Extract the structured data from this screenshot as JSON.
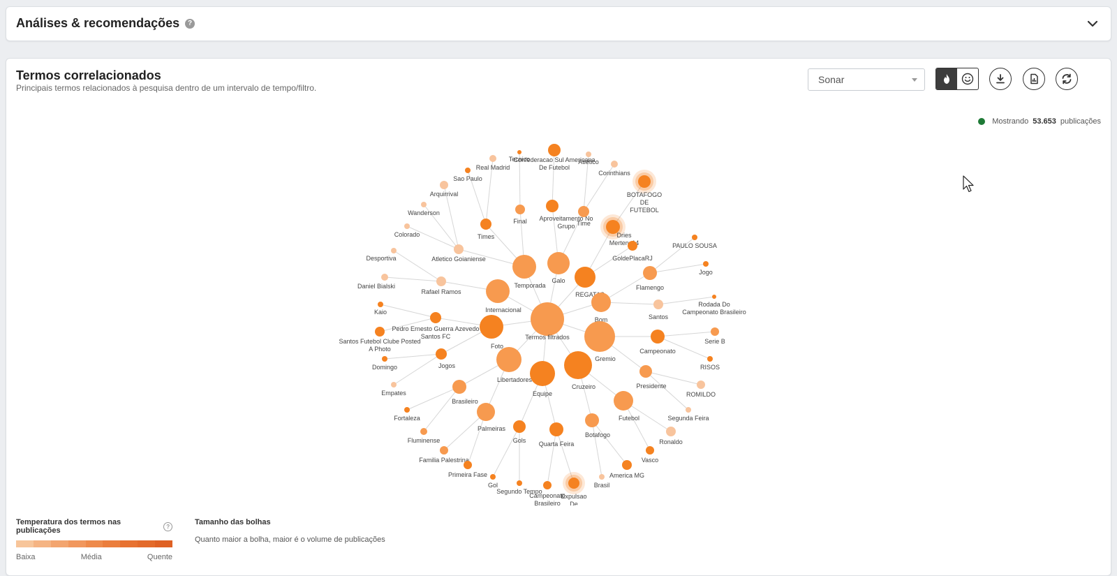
{
  "analises": {
    "title": "Análises & recomendações",
    "help": "?"
  },
  "termos": {
    "title": "Termos correlacionados",
    "subtitle": "Principais termos relacionados à pesquisa dentro de um intervalo de tempo/filtro.",
    "select_value": "Sonar",
    "showing_label": "Mostrando",
    "showing_count": "53.653",
    "showing_suffix": "publicações"
  },
  "legend": {
    "temp_title": "Temperatura dos termos nas publicações",
    "temp_low": "Baixa",
    "temp_mid": "Média",
    "temp_high": "Quente",
    "gradient": [
      "#f7c59a",
      "#f5b483",
      "#f3a56f",
      "#f1975d",
      "#ee8a4b",
      "#eb7e3d",
      "#e77231",
      "#e36a2a",
      "#df6124"
    ],
    "size_title": "Tamanho das bolhas",
    "size_desc": "Quanto maior a bolha, maior é o volume de publicações"
  },
  "colors": {
    "hot": "#f58220",
    "medium": "#f79a4f",
    "low": "#f8c49d",
    "link": "#d6d6d6"
  },
  "graph": {
    "center": {
      "label": "Termos filtrados",
      "heat": "medium"
    },
    "nodes": [
      {
        "id": "temporada",
        "label": "Temporada",
        "heat": "medium",
        "parent": "center"
      },
      {
        "id": "galo",
        "label": "Galo",
        "heat": "medium",
        "parent": "center"
      },
      {
        "id": "regatas",
        "label": "REGATAS",
        "heat": "hot",
        "parent": "center"
      },
      {
        "id": "bom",
        "label": "Bom",
        "heat": "medium",
        "parent": "center"
      },
      {
        "id": "internacional",
        "label": "Internacional",
        "heat": "medium",
        "parent": "center"
      },
      {
        "id": "gremio",
        "label": "Gremio",
        "heat": "medium",
        "parent": "center"
      },
      {
        "id": "foto",
        "label": "Foto",
        "heat": "hot",
        "parent": "center"
      },
      {
        "id": "libertadores",
        "label": "Libertadores",
        "heat": "medium",
        "parent": "center"
      },
      {
        "id": "equipe",
        "label": "Equipe",
        "heat": "hot",
        "parent": "center"
      },
      {
        "id": "cruzeiro",
        "label": "Cruzeiro",
        "heat": "hot",
        "parent": "center"
      },
      {
        "id": "campeonato",
        "label": "Campeonato",
        "heat": "hot",
        "parent": "gremio"
      },
      {
        "id": "presidente",
        "label": "Presidente",
        "heat": "medium",
        "parent": "gremio"
      },
      {
        "id": "futebol",
        "label": "Futebol",
        "heat": "medium",
        "parent": "cruzeiro"
      },
      {
        "id": "botafogo",
        "label": "Botafogo",
        "heat": "medium",
        "parent": "cruzeiro"
      },
      {
        "id": "quartafeira",
        "label": "Quarta Feira",
        "heat": "hot",
        "parent": "equipe"
      },
      {
        "id": "gols",
        "label": "Gols",
        "heat": "hot",
        "parent": "equipe"
      },
      {
        "id": "palmeiras",
        "label": "Palmeiras",
        "heat": "medium",
        "parent": "libertadores"
      },
      {
        "id": "brasileiro",
        "label": "Brasileiro",
        "heat": "medium",
        "parent": "libertadores"
      },
      {
        "id": "jogos",
        "label": "Jogos",
        "heat": "hot",
        "parent": "foto"
      },
      {
        "id": "pedro",
        "label": "Pedro Ernesto Guerra Azevedo Santos FC",
        "heat": "hot",
        "parent": "foto"
      },
      {
        "id": "rafael",
        "label": "Rafael Ramos",
        "heat": "low",
        "parent": "internacional"
      },
      {
        "id": "atleticogo",
        "label": "Atletico Goianiense",
        "heat": "low",
        "parent": "temporada"
      },
      {
        "id": "times",
        "label": "Times",
        "heat": "hot",
        "parent": "temporada"
      },
      {
        "id": "final",
        "label": "Final",
        "heat": "medium",
        "parent": "temporada"
      },
      {
        "id": "aproveitamento",
        "label": "Aproveitamento No Grupo",
        "heat": "hot",
        "parent": "galo"
      },
      {
        "id": "time",
        "label": "Time",
        "heat": "medium",
        "parent": "galo"
      },
      {
        "id": "dries",
        "label": "Dries Mertens14",
        "heat": "hot",
        "parent": "regatas",
        "halo": true
      },
      {
        "id": "golde",
        "label": "GoldePlacaRJ",
        "heat": "hot",
        "parent": "regatas"
      },
      {
        "id": "flamengo",
        "label": "Flamengo",
        "heat": "medium",
        "parent": "bom"
      },
      {
        "id": "santos",
        "label": "Santos",
        "heat": "low",
        "parent": "bom"
      },
      {
        "id": "confederacao",
        "label": "Confederacao Sul Americana De Futebol",
        "heat": "hot",
        "parent": "aproveitamento"
      },
      {
        "id": "tecnico",
        "label": "Tecnico",
        "heat": "hot",
        "parent": "final"
      },
      {
        "id": "realmadrid",
        "label": "Real Madrid",
        "heat": "low",
        "parent": "times"
      },
      {
        "id": "saopaulo",
        "label": "Sao Paulo",
        "heat": "hot",
        "parent": "times"
      },
      {
        "id": "arquirrival",
        "label": "Arquirrival",
        "heat": "low",
        "parent": "atleticogo"
      },
      {
        "id": "wanderson",
        "label": "Wanderson",
        "heat": "low",
        "parent": "atleticogo"
      },
      {
        "id": "colorado",
        "label": "Colorado",
        "heat": "low",
        "parent": "atleticogo"
      },
      {
        "id": "desportiva",
        "label": "Desportiva",
        "heat": "low",
        "parent": "rafael"
      },
      {
        "id": "danielb",
        "label": "Daniel Bialski",
        "heat": "low",
        "parent": "rafael"
      },
      {
        "id": "kaio",
        "label": "Kaio",
        "heat": "hot",
        "parent": "pedro"
      },
      {
        "id": "santosfc",
        "label": "Santos Futebol Clube Posted A Photo",
        "heat": "hot",
        "parent": "pedro"
      },
      {
        "id": "domingo",
        "label": "Domingo",
        "heat": "hot",
        "parent": "jogos"
      },
      {
        "id": "empates",
        "label": "Empates",
        "heat": "low",
        "parent": "jogos"
      },
      {
        "id": "fortaleza",
        "label": "Fortaleza",
        "heat": "hot",
        "parent": "brasileiro"
      },
      {
        "id": "fluminense",
        "label": "Fluminense",
        "heat": "medium",
        "parent": "brasileiro"
      },
      {
        "id": "familia",
        "label": "Familia Palestrina",
        "heat": "medium",
        "parent": "palmeiras"
      },
      {
        "id": "primeirafase",
        "label": "Primeira Fase",
        "heat": "hot",
        "parent": "palmeiras"
      },
      {
        "id": "gol",
        "label": "Gol",
        "heat": "hot",
        "parent": "gols"
      },
      {
        "id": "segundotempo",
        "label": "Segundo Tempo",
        "heat": "hot",
        "parent": "gols"
      },
      {
        "id": "campeonatob",
        "label": "Campeonato Brasileiro",
        "heat": "hot",
        "parent": "quartafeira"
      },
      {
        "id": "expulsao",
        "label": "Expulsao De",
        "heat": "hot",
        "parent": "quartafeira",
        "halo": true
      },
      {
        "id": "brasil",
        "label": "Brasil",
        "heat": "low",
        "parent": "botafogo"
      },
      {
        "id": "americamg",
        "label": "America MG",
        "heat": "hot",
        "parent": "botafogo"
      },
      {
        "id": "vasco",
        "label": "Vasco",
        "heat": "hot",
        "parent": "futebol"
      },
      {
        "id": "ronaldo",
        "label": "Ronaldo",
        "heat": "low",
        "parent": "futebol"
      },
      {
        "id": "segundafeira",
        "label": "Segunda Feira",
        "heat": "low",
        "parent": "presidente"
      },
      {
        "id": "romildo",
        "label": "ROMILDO",
        "heat": "low",
        "parent": "presidente"
      },
      {
        "id": "risos",
        "label": "RISOS",
        "heat": "hot",
        "parent": "campeonato"
      },
      {
        "id": "serieb",
        "label": "Serie B",
        "heat": "medium",
        "parent": "campeonato"
      },
      {
        "id": "rodada",
        "label": "Rodada Do Campeonato Brasileiro",
        "heat": "hot",
        "parent": "santos"
      },
      {
        "id": "jogo",
        "label": "Jogo",
        "heat": "hot",
        "parent": "flamengo"
      },
      {
        "id": "paulosousa",
        "label": "PAULO SOUSA",
        "heat": "hot",
        "parent": "flamengo"
      },
      {
        "id": "botafogofut",
        "label": "BOTAFOGO DE FUTEBOL",
        "heat": "hot",
        "parent": "dries",
        "halo": true
      },
      {
        "id": "corinthians",
        "label": "Corinthians",
        "heat": "low",
        "parent": "time"
      },
      {
        "id": "atletico",
        "label": "Atletico",
        "heat": "low",
        "parent": "time"
      }
    ]
  }
}
